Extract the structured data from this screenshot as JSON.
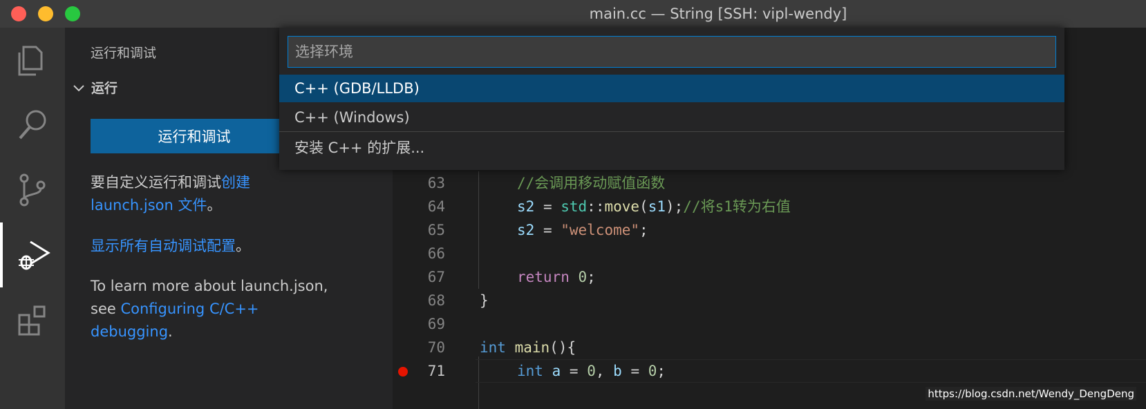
{
  "window": {
    "title": "main.cc — String [SSH: vipl-wendy]"
  },
  "activity_bar": {
    "items": [
      "explorer-icon",
      "search-icon",
      "source-control-icon",
      "run-debug-icon",
      "extensions-icon"
    ],
    "active": "run-debug-icon"
  },
  "sidebar": {
    "title": "运行和调试",
    "section": "运行",
    "run_button": "运行和调试",
    "para1_text": "要自定义运行和调试",
    "para1_link1": "创建",
    "para1_link2": "launch.json 文件",
    "para1_end": "。",
    "para2_link": "显示所有自动调试配置",
    "para2_end": "。",
    "para3_text1": "To learn more about launch.json,",
    "para3_text2": "see ",
    "para3_link1": "Configuring C/C++",
    "para3_link2": "debugging",
    "para3_end": "."
  },
  "quick_pick": {
    "placeholder": "选择环境",
    "items": [
      "C++ (GDB/LLDB)",
      "C++ (Windows)",
      "安装 C++ 的扩展..."
    ],
    "selected_index": 0
  },
  "editor": {
    "line_numbers": [
      "63",
      "64",
      "65",
      "66",
      "67",
      "68",
      "69",
      "70",
      "71"
    ],
    "breakpoint_line": "71",
    "tokens": {
      "l63_comment": "//会调用移动赋值函数",
      "l64_s2": "s2",
      "l64_eq": " = ",
      "l64_std": "std",
      "l64_sep": "::",
      "l64_move": "move",
      "l64_open": "(",
      "l64_s1": "s1",
      "l64_close": ");",
      "l64_comment": "//将s1转为右值",
      "l65_s2": "s2",
      "l65_eq": " = ",
      "l65_str": "\"welcome\"",
      "l65_end": ";",
      "l67_return": "return",
      "l67_num": "0",
      "l67_end": ";",
      "l68_brace": "}",
      "l70_int": "int",
      "l70_main": "main",
      "l70_rest": "(){",
      "l71_int": "int",
      "l71_a": "a",
      "l71_eq1": " = ",
      "l71_zero1": "0",
      "l71_comma": ", ",
      "l71_b": "b",
      "l71_eq2": " = ",
      "l71_zero2": "0",
      "l71_end": ";"
    }
  },
  "watermark": "https://blog.csdn.net/Wendy_DengDeng"
}
